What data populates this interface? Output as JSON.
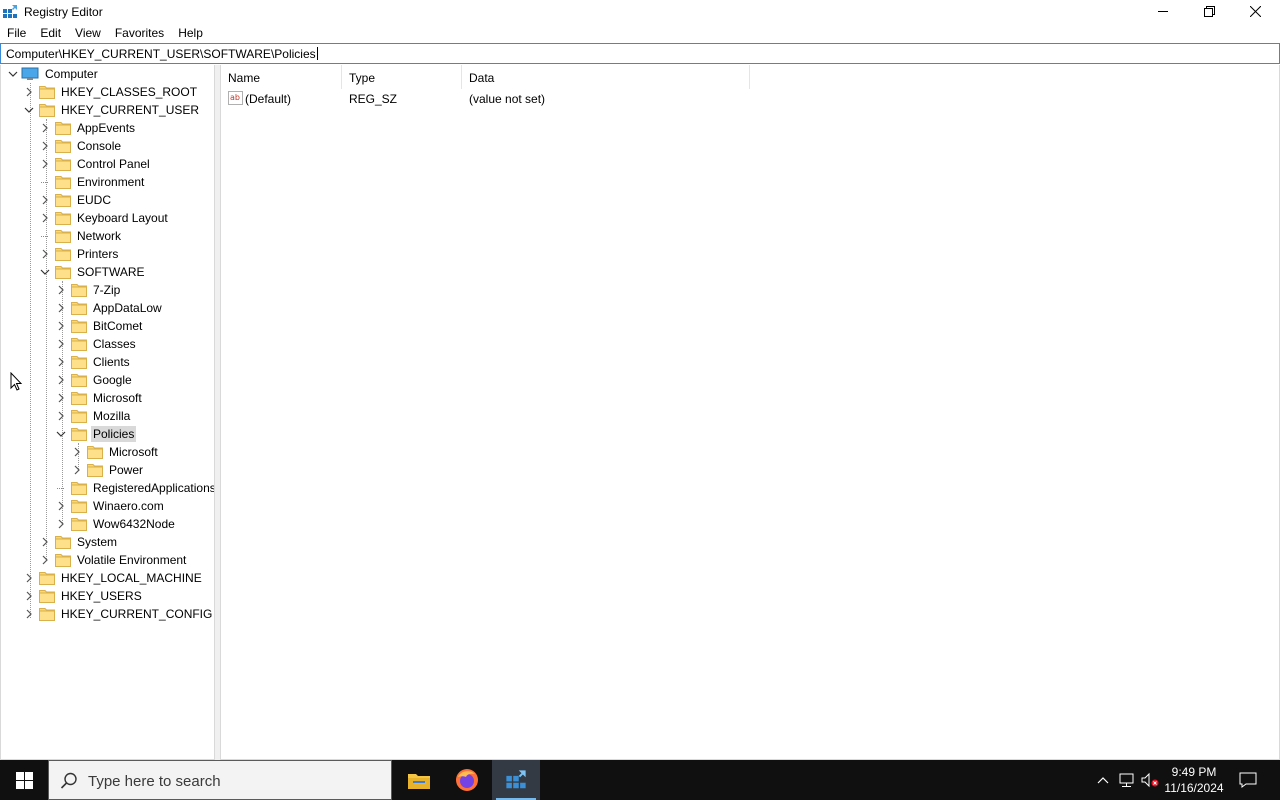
{
  "window": {
    "title": "Registry Editor",
    "icon": "regedit-icon",
    "controls": [
      "minimize-icon",
      "restore-icon",
      "close-icon"
    ]
  },
  "menubar": {
    "items": [
      "File",
      "Edit",
      "View",
      "Favorites",
      "Help"
    ]
  },
  "address": {
    "path": "Computer\\HKEY_CURRENT_USER\\SOFTWARE\\Policies"
  },
  "tree": {
    "root": "Computer",
    "nodes": [
      {
        "label": "HKEY_CLASSES_ROOT",
        "level": 1,
        "state": "collapsed"
      },
      {
        "label": "HKEY_CURRENT_USER",
        "level": 1,
        "state": "expanded"
      },
      {
        "label": "AppEvents",
        "level": 2,
        "state": "collapsed"
      },
      {
        "label": "Console",
        "level": 2,
        "state": "collapsed"
      },
      {
        "label": "Control Panel",
        "level": 2,
        "state": "collapsed"
      },
      {
        "label": "Environment",
        "level": 2,
        "state": "leaf"
      },
      {
        "label": "EUDC",
        "level": 2,
        "state": "collapsed"
      },
      {
        "label": "Keyboard Layout",
        "level": 2,
        "state": "collapsed"
      },
      {
        "label": "Network",
        "level": 2,
        "state": "leaf"
      },
      {
        "label": "Printers",
        "level": 2,
        "state": "collapsed"
      },
      {
        "label": "SOFTWARE",
        "level": 2,
        "state": "expanded"
      },
      {
        "label": "7-Zip",
        "level": 3,
        "state": "collapsed"
      },
      {
        "label": "AppDataLow",
        "level": 3,
        "state": "collapsed"
      },
      {
        "label": "BitComet",
        "level": 3,
        "state": "collapsed"
      },
      {
        "label": "Classes",
        "level": 3,
        "state": "collapsed"
      },
      {
        "label": "Clients",
        "level": 3,
        "state": "collapsed"
      },
      {
        "label": "Google",
        "level": 3,
        "state": "collapsed"
      },
      {
        "label": "Microsoft",
        "level": 3,
        "state": "collapsed"
      },
      {
        "label": "Mozilla",
        "level": 3,
        "state": "collapsed"
      },
      {
        "label": "Policies",
        "level": 3,
        "state": "expanded",
        "selected": true
      },
      {
        "label": "Microsoft",
        "level": 4,
        "state": "collapsed"
      },
      {
        "label": "Power",
        "level": 4,
        "state": "collapsed"
      },
      {
        "label": "RegisteredApplications",
        "level": 3,
        "state": "leaf"
      },
      {
        "label": "Winaero.com",
        "level": 3,
        "state": "collapsed"
      },
      {
        "label": "Wow6432Node",
        "level": 3,
        "state": "collapsed"
      },
      {
        "label": "System",
        "level": 2,
        "state": "collapsed"
      },
      {
        "label": "Volatile Environment",
        "level": 2,
        "state": "collapsed"
      },
      {
        "label": "HKEY_LOCAL_MACHINE",
        "level": 1,
        "state": "collapsed"
      },
      {
        "label": "HKEY_USERS",
        "level": 1,
        "state": "collapsed"
      },
      {
        "label": "HKEY_CURRENT_CONFIG",
        "level": 1,
        "state": "collapsed"
      }
    ]
  },
  "values": {
    "columns": [
      "Name",
      "Type",
      "Data"
    ],
    "rows": [
      {
        "name": "(Default)",
        "type": "REG_SZ",
        "data": "(value not set)",
        "icon": "string-value-icon"
      }
    ]
  },
  "taskbar": {
    "search_placeholder": "Type here to search",
    "apps": [
      "file-explorer-icon",
      "firefox-icon",
      "regedit-icon"
    ],
    "active_app": "regedit-icon",
    "time": "9:49 PM",
    "date": "11/16/2024",
    "colors": {
      "accent": "#76b9ed",
      "taskbar": "#101010"
    }
  }
}
